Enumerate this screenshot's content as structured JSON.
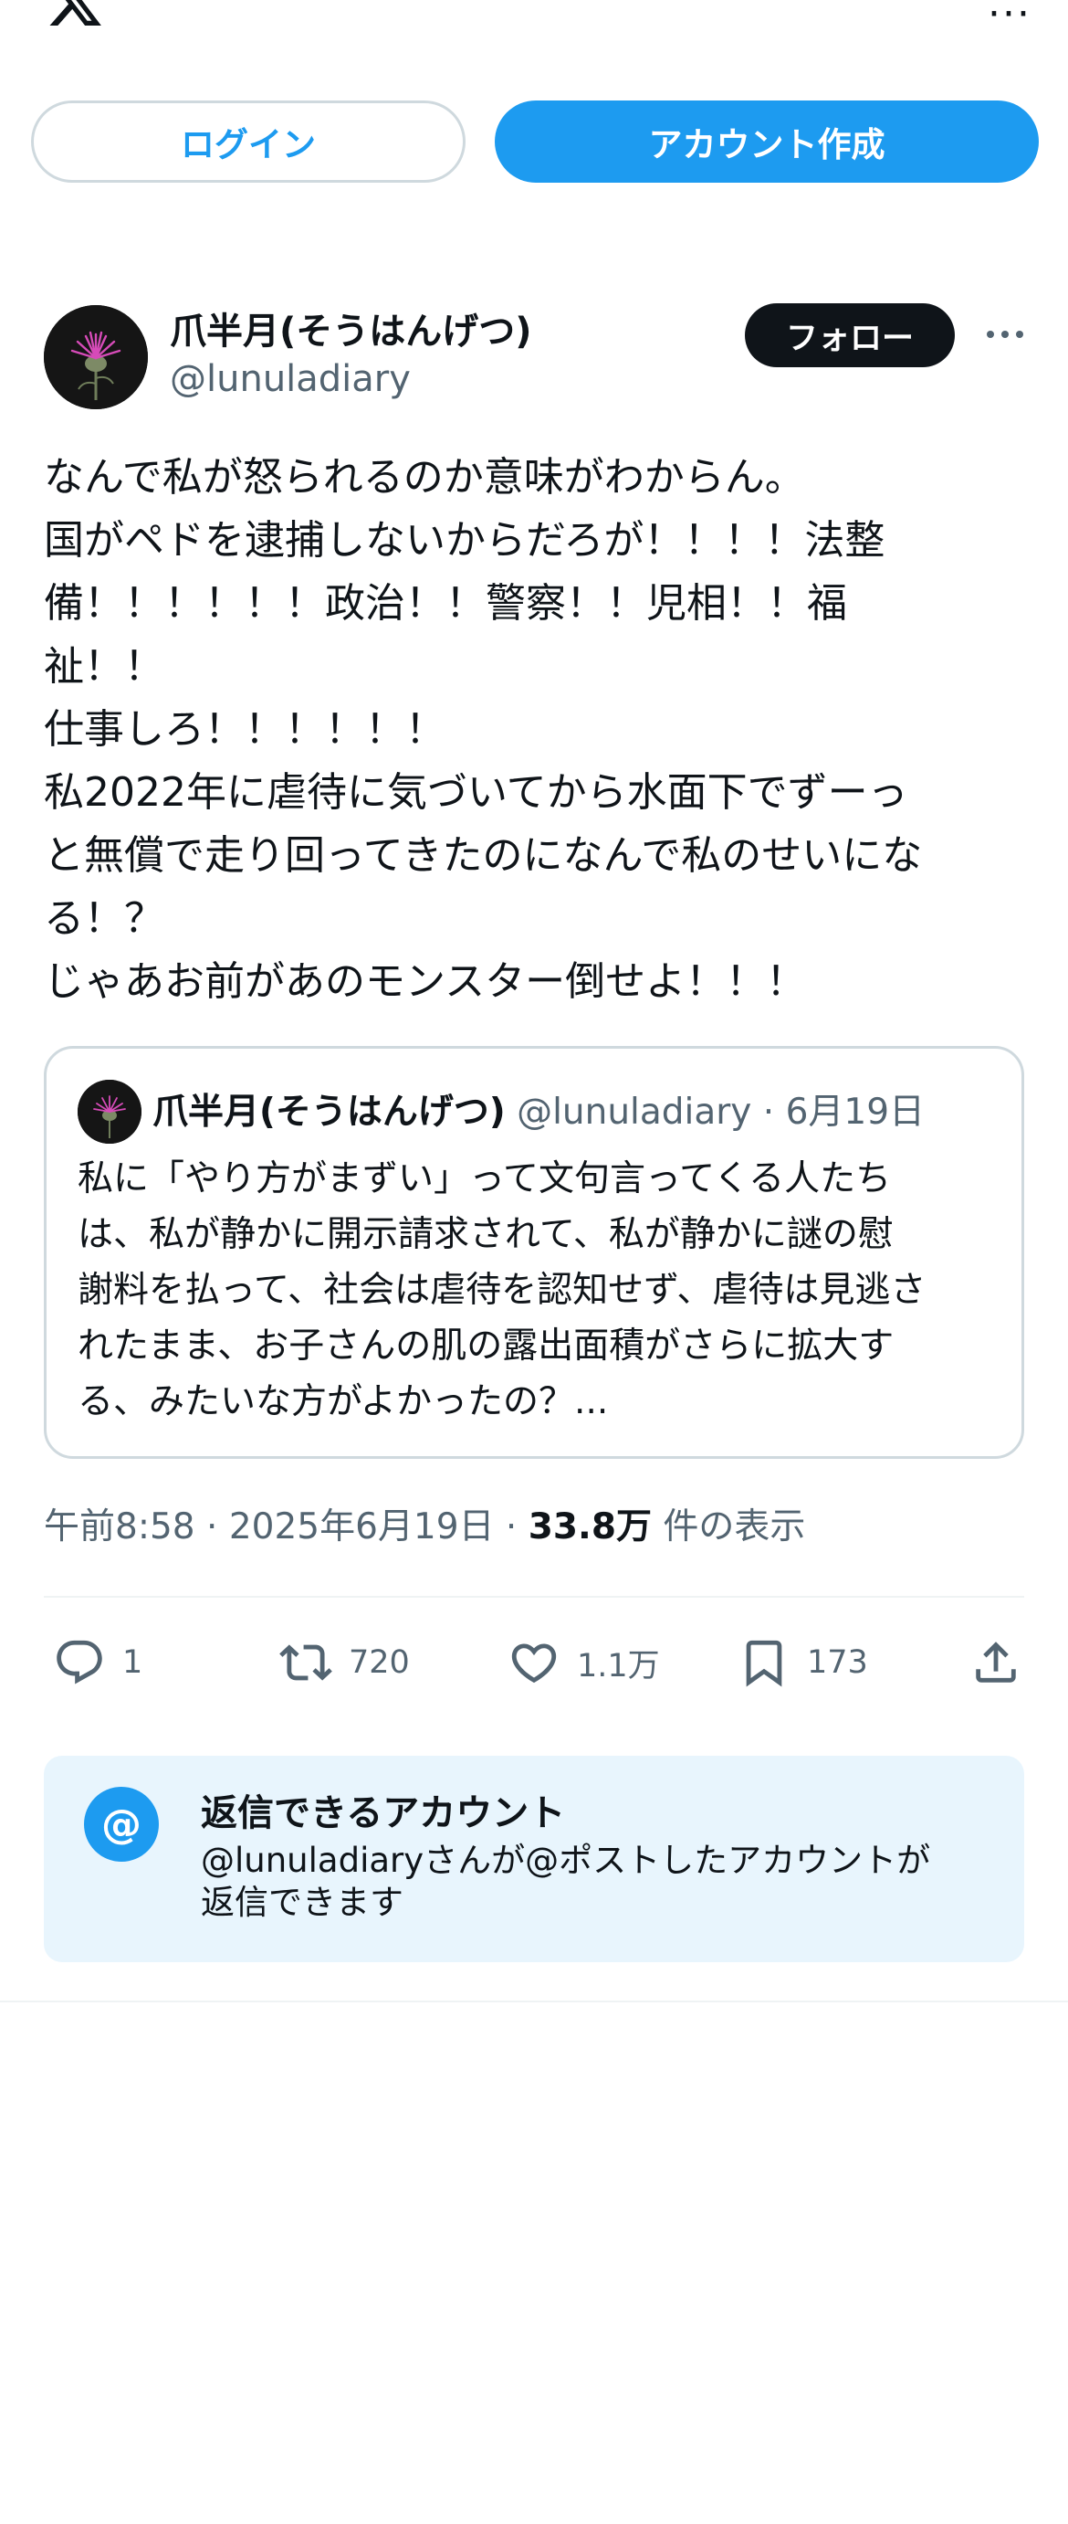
{
  "header": {
    "more_label": "···"
  },
  "auth": {
    "login_label": "ログイン",
    "signup_label": "アカウント作成"
  },
  "post": {
    "author_name": "爪半月(そうはんげつ)",
    "author_handle": "@lunuladiary",
    "follow_label": "フォロー",
    "lines": [
      "なんで私が怒られるのか意味がわからん。",
      "国がペドを逮捕しないからだろが！！！！法整",
      "備！！！！！！政治！！警察！！児相！！福",
      "祉！！",
      "仕事しろ！！！！！！",
      "私2022年に虐待に気づいてから水面下でずーっ",
      "と無償で走り回ってきたのになんで私のせいにな",
      "る！？",
      "じゃあお前があのモンスター倒せよ！！！"
    ],
    "time": "午前8:58",
    "date": "2025年6月19日",
    "views_count": "33.8万",
    "views_label": "件の表示",
    "sep": "·"
  },
  "quote": {
    "author_name": "爪半月(そうはんげつ)",
    "author_handle": "@lunuladiary",
    "date": "6月19日",
    "sep": "·",
    "lines": [
      "私に「やり方がまずい」って文句言ってくる人たち",
      "は、私が静かに開示請求されて、私が静かに謎の慰",
      "謝料を払って、社会は虐待を認知せず、虐待は見逃さ",
      "れたまま、お子さんの肌の露出面積がさらに拡大す",
      "る、みたいな方がよかったの？..."
    ]
  },
  "actions": {
    "replies": "1",
    "reposts": "720",
    "likes": "1.1万",
    "bookmarks": "173"
  },
  "reply_settings": {
    "badge": "@",
    "title": "返信できるアカウント",
    "desc_lines": [
      "@lunuladiaryさんが@ポストしたアカウントが",
      "返信できます"
    ]
  },
  "colors": {
    "accent": "#1d9bf0",
    "text": "#0f1419",
    "secondary": "#536471",
    "border": "#cfd9de",
    "reply_box_bg": "#e8f5fd"
  }
}
